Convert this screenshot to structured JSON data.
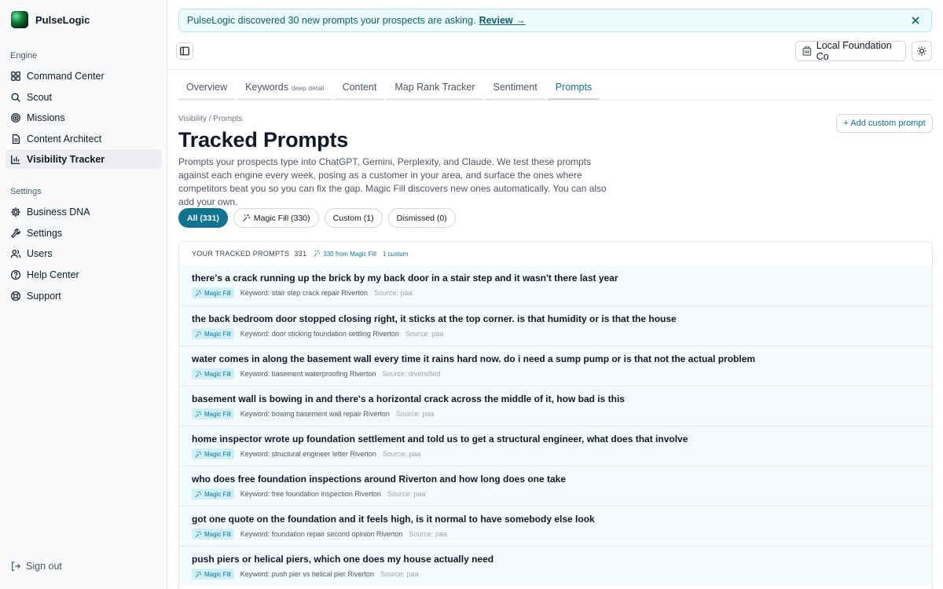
{
  "app": {
    "name": "PulseLogic"
  },
  "sidebar": {
    "engine_section": "Engine",
    "engine_items": [
      {
        "label": "Command Center",
        "icon": "grid-icon"
      },
      {
        "label": "Scout",
        "icon": "search-icon"
      },
      {
        "label": "Missions",
        "icon": "target-icon"
      },
      {
        "label": "Content Architect",
        "icon": "document-icon"
      },
      {
        "label": "Visibility Tracker",
        "icon": "bar-chart-icon",
        "active": true
      }
    ],
    "settings_section": "Settings",
    "settings_items": [
      {
        "label": "Business DNA",
        "icon": "gear-icon"
      },
      {
        "label": "Settings",
        "icon": "wrench-icon"
      },
      {
        "label": "Users",
        "icon": "users-icon"
      },
      {
        "label": "Help Center",
        "icon": "help-circle-icon"
      },
      {
        "label": "Support",
        "icon": "lifebuoy-icon"
      }
    ],
    "sign_out": "Sign out"
  },
  "banner": {
    "text": "PulseLogic discovered 30 new prompts your prospects are asking.",
    "link": "Review →"
  },
  "header": {
    "org_name": "Local Foundation Co"
  },
  "tabs": [
    {
      "label": "Overview",
      "sub": ""
    },
    {
      "label": "Keywords",
      "sub": "deep detail"
    },
    {
      "label": "Content",
      "sub": ""
    },
    {
      "label": "Map Rank Tracker",
      "sub": ""
    },
    {
      "label": "Sentiment",
      "sub": ""
    },
    {
      "label": "Prompts",
      "sub": "",
      "active": true
    }
  ],
  "page": {
    "breadcrumb": "Visibility / Prompts",
    "title": "Tracked Prompts",
    "description": "Prompts your prospects type into ChatGPT, Gemini, Perplexity, and Claude. We test these prompts against each engine every week, posing as a customer in your area, and surface the ones where competitors beat you so you can fix the gap. Magic Fill discovers new ones automatically. You can also add your own.",
    "add_button": "+ Add custom prompt"
  },
  "filters": [
    {
      "label": "All (331)",
      "active": true
    },
    {
      "label": "Magic Fill (330)",
      "icon": "sparkle-icon"
    },
    {
      "label": "Custom (1)"
    },
    {
      "label": "Dismissed (0)"
    }
  ],
  "list": {
    "heading": "YOUR TRACKED PROMPTS",
    "count": "331",
    "magic_fill_count": "330 from Magic Fill",
    "custom_count": "1 custom",
    "badge_label": "Magic Fill",
    "rows": [
      {
        "prompt": "there's a crack running up the brick by my back door in a stair step and it wasn't there last year",
        "keyword": "Keyword: stair step crack repair Riverton",
        "source": "Source: paa"
      },
      {
        "prompt": "the back bedroom door stopped closing right, it sticks at the top corner. is that humidity or is that the house",
        "keyword": "Keyword: door sticking foundation settling Riverton",
        "source": "Source: paa"
      },
      {
        "prompt": "water comes in along the basement wall every time it rains hard now. do i need a sump pump or is that not the actual problem",
        "keyword": "Keyword: basement waterproofing Riverton",
        "source": "Source: diversified"
      },
      {
        "prompt": "basement wall is bowing in and there's a horizontal crack across the middle of it, how bad is this",
        "keyword": "Keyword: bowing basement wall repair Riverton",
        "source": "Source: paa"
      },
      {
        "prompt": "home inspector wrote up foundation settlement and told us to get a structural engineer, what does that involve",
        "keyword": "Keyword: structural engineer letter Riverton",
        "source": "Source: paa"
      },
      {
        "prompt": "who does free foundation inspections around Riverton and how long does one take",
        "keyword": "Keyword: free foundation inspection Riverton",
        "source": "Source: paa"
      },
      {
        "prompt": "got one quote on the foundation and it feels high, is it normal to have somebody else look",
        "keyword": "Keyword: foundation repair second opinion Riverton",
        "source": "Source: paa"
      },
      {
        "prompt": "push piers or helical piers, which one does my house actually need",
        "keyword": "Keyword: push pier vs helical pier Riverton",
        "source": "Source: paa"
      }
    ]
  },
  "colors": {
    "accent": "#0e7490",
    "banner_bg": "#ecfbfc",
    "row_bg": "#f4fbfd"
  }
}
